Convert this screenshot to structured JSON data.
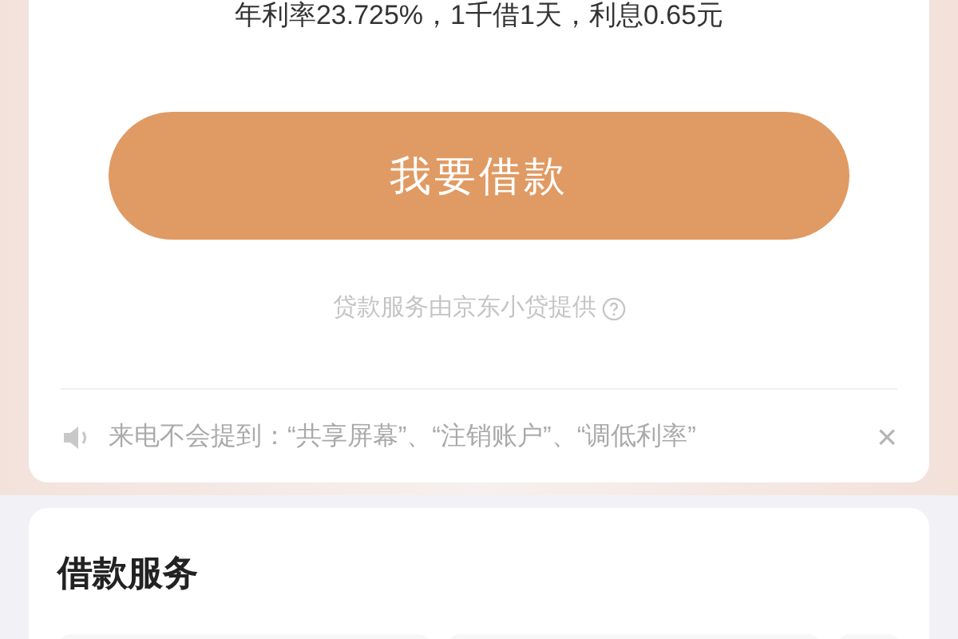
{
  "rate_text": "年利率23.725%，1千借1天，利息0.65元",
  "borrow_button": "我要借款",
  "provider_text": "贷款服务由京东小贷提供",
  "notice": {
    "text": "来电不会提到：“共享屏幕”、“注销账户”、“调低利率”",
    "close": "×"
  },
  "services": {
    "title": "借款服务"
  }
}
